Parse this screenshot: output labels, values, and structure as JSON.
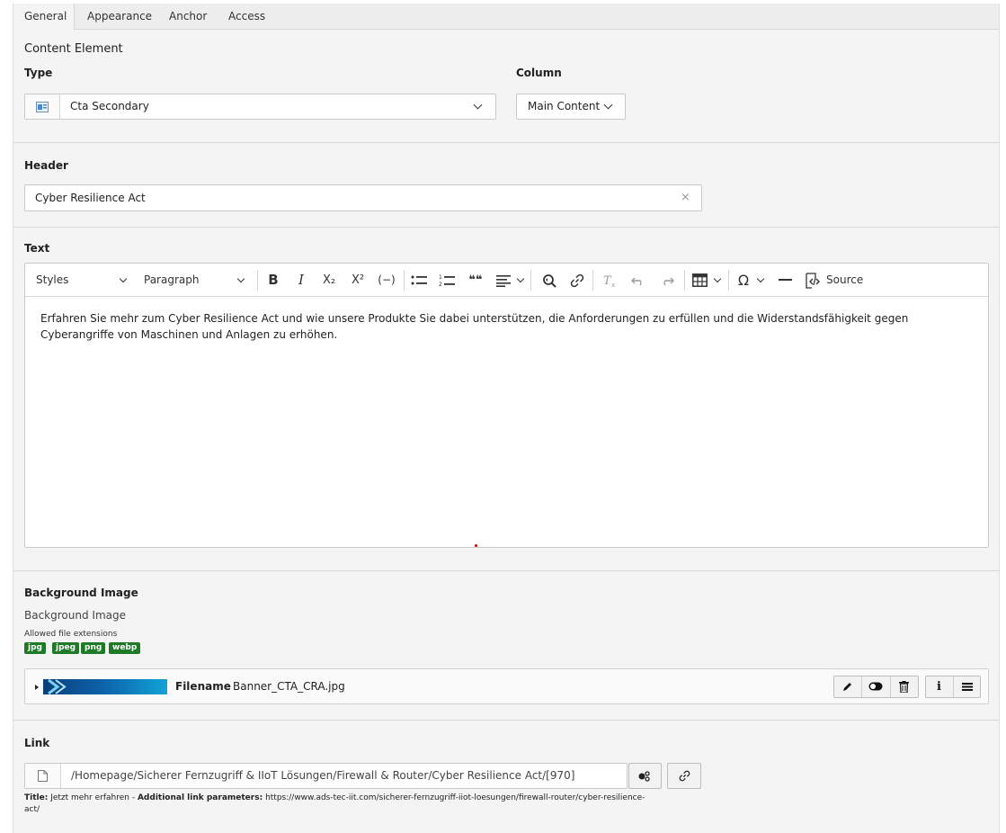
{
  "tabs": [
    "General",
    "Appearance",
    "Anchor",
    "Access"
  ],
  "content_element": {
    "title": "Content Element",
    "type_label": "Type",
    "type_value": "Cta Secondary",
    "column_label": "Column",
    "column_value": "Main Content"
  },
  "header": {
    "label": "Header",
    "value": "Cyber Resilience Act",
    "clear_icon": "×"
  },
  "text": {
    "label": "Text",
    "toolbar": {
      "styles": "Styles",
      "paragraph": "Paragraph",
      "bold": "B",
      "italic": "I",
      "subscript": "X₂",
      "superscript": "X²",
      "soft_hyphen": "(−)",
      "quote": "❝❝",
      "special_chars": "Ω",
      "source": "Source"
    },
    "body": "Erfahren Sie mehr zum Cyber Resilience Act und wie unsere Produkte Sie dabei unterstützen, die Anforderungen zu erfüllen und die Widerstandsfähigkeit gegen Cyberangriffe von Maschinen und Anlagen zu erhöhen."
  },
  "background_image": {
    "label": "Background Image",
    "sublabel": "Background Image",
    "allowed_label": "Allowed file extensions",
    "extensions": [
      "jpg",
      "jpeg",
      "png",
      "webp"
    ],
    "file_label": "Filename",
    "file_name": "Banner_CTA_CRA.jpg"
  },
  "link": {
    "label": "Link",
    "value": "/Homepage/Sicherer Fernzugriff & IIoT Lösungen/Firewall & Router/Cyber Resilience Act/[970]",
    "title_key": "Title:",
    "title_value": "Jetzt mehr erfahren -",
    "params_key": "Additional link parameters:",
    "params_value": "https://www.ads-tec-iit.com/sicherer-fernzugriff-iiot-loesungen/firewall-router/cyber-resilience-act/"
  },
  "colors": {
    "extension_badge": "#1d7a26",
    "background": "#f4f4f4"
  },
  "icons": {
    "type": "content-element-icon",
    "file_page": "page-icon",
    "edit": "pencil-icon",
    "toggle": "toggle-icon",
    "delete": "trash-icon",
    "info": "info-icon",
    "menu": "hamburger-icon",
    "browse": "page-tree-icon",
    "link": "link-icon"
  }
}
